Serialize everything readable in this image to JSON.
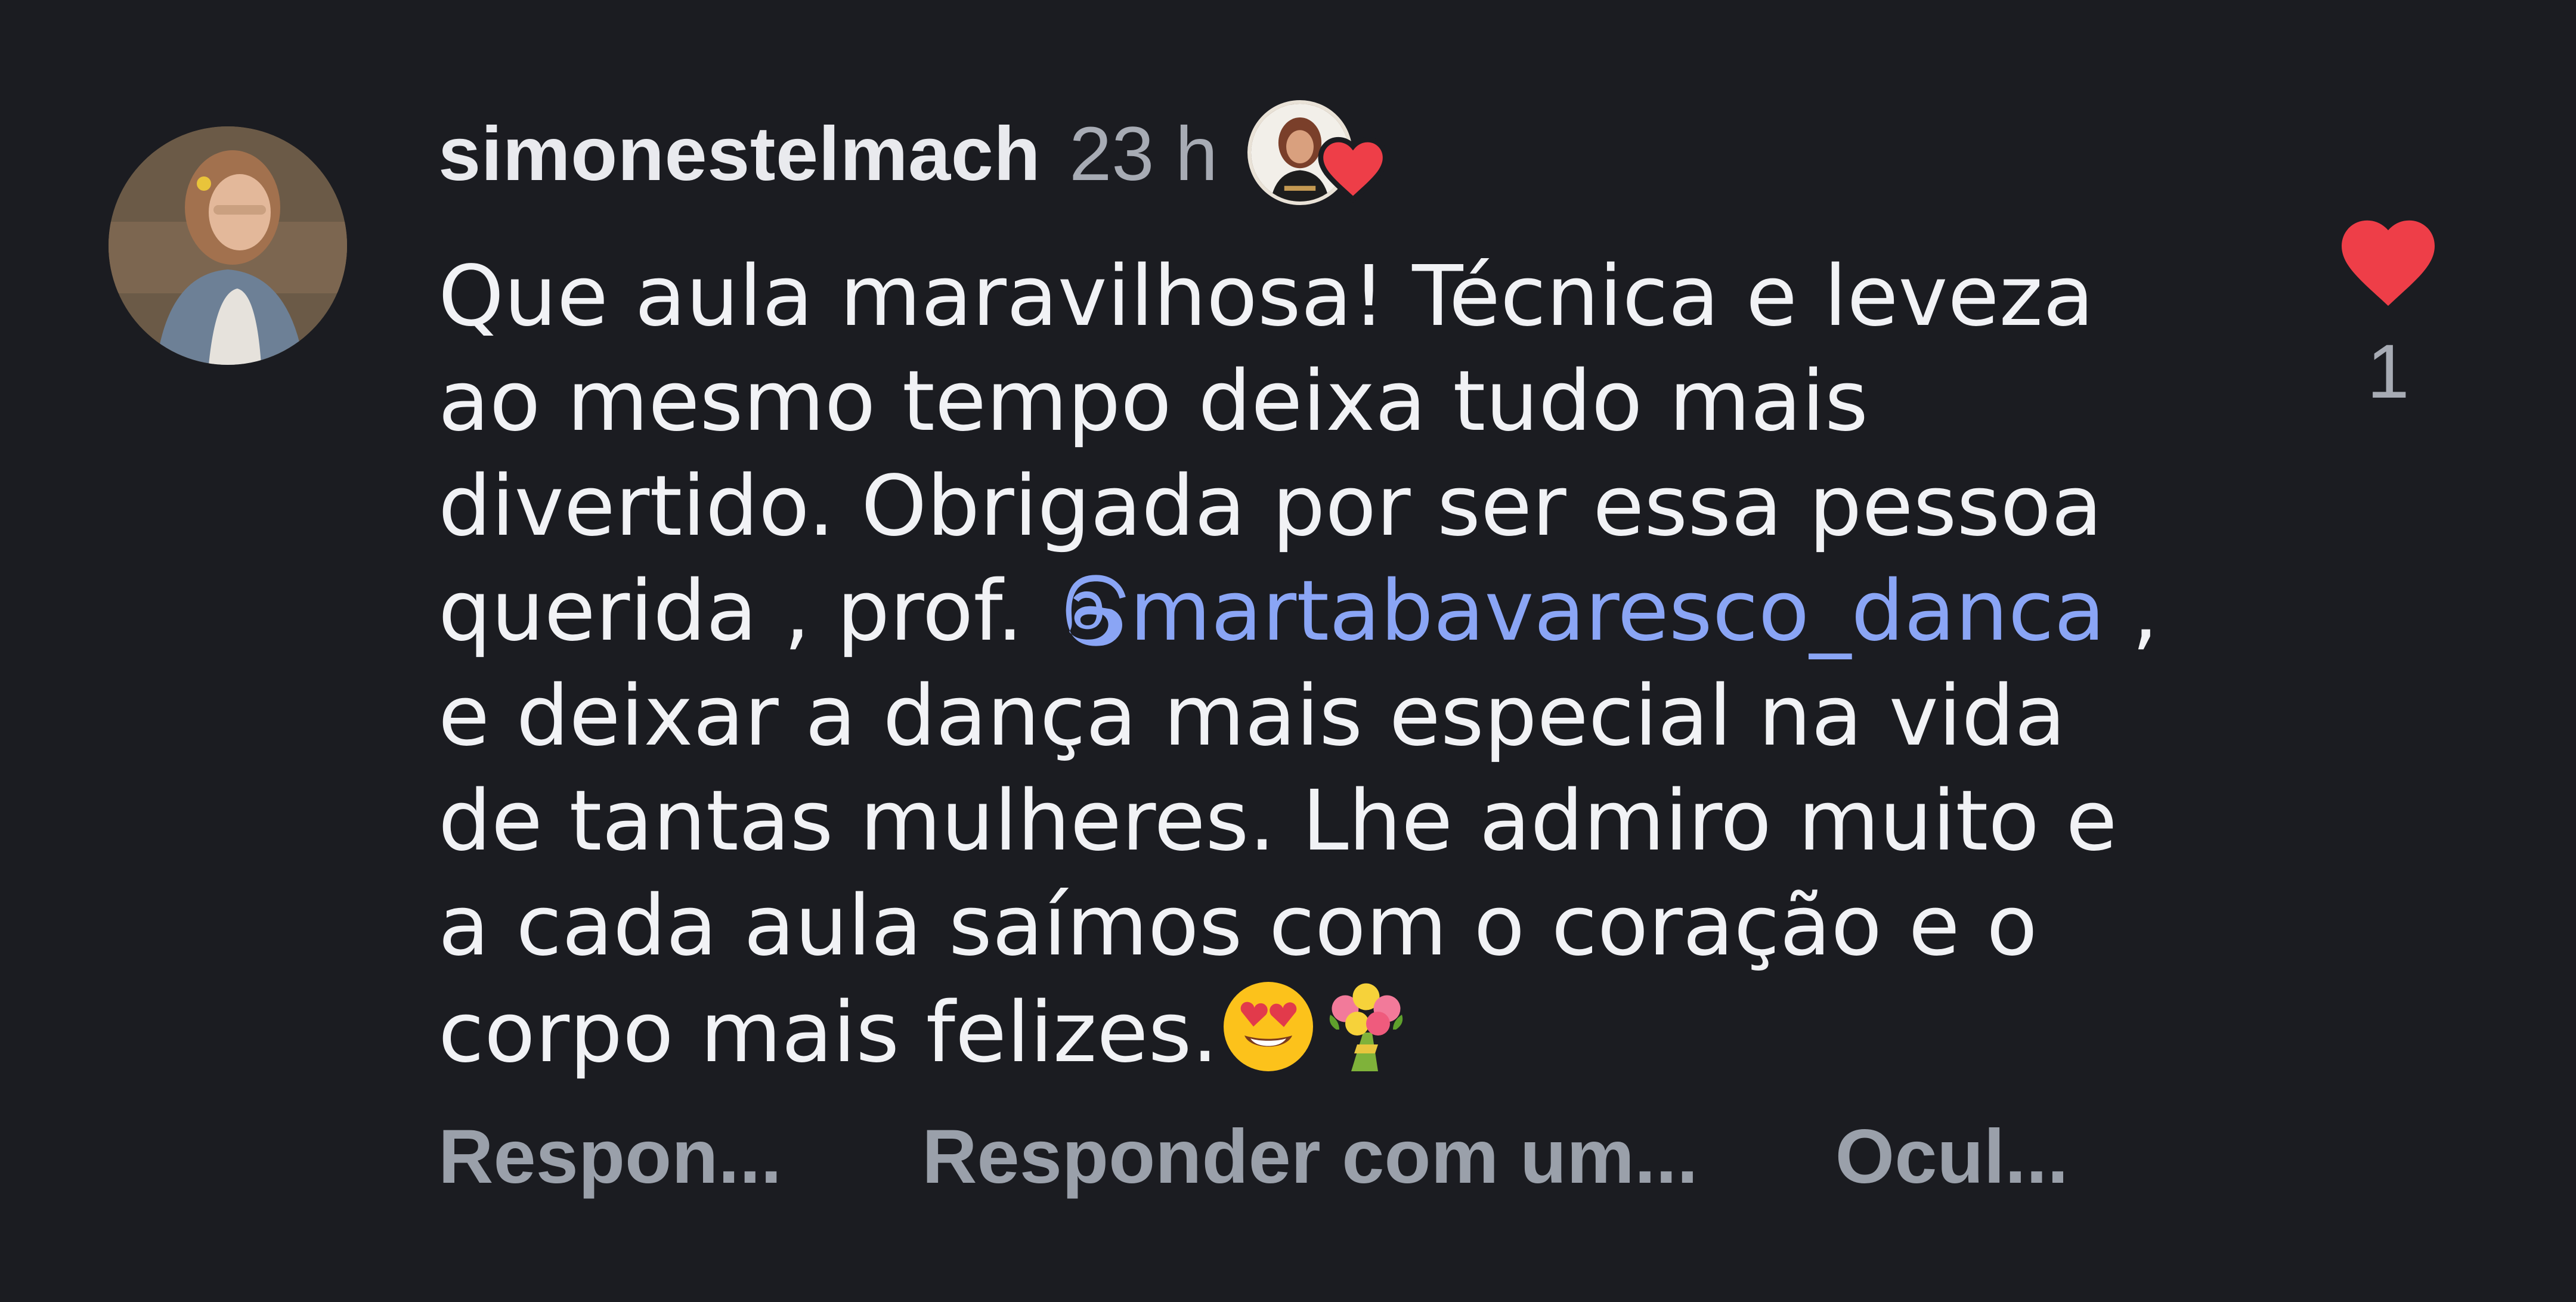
{
  "comment": {
    "username": "simonestelmach",
    "timestamp": "23 h",
    "text_before_mention": "Que aula maravilhosa! Técnica e leveza\nao mesmo tempo deixa tudo mais\ndivertido. Obrigada por ser essa pessoa\nquerida , prof. ",
    "mention": "martabavaresco_danca",
    "text_after_mention": " ,\ne deixar a dança mais especial na vida\nde tantas mulheres. Lhe admiro muito e\na cada aula saímos com o coração e o\ncorpo mais felizes.",
    "emojis": [
      "heart-eyes-emoji",
      "bouquet-emoji"
    ],
    "liked_by_creator": true
  },
  "like": {
    "count": "1",
    "liked": true,
    "color": "#ee3e48"
  },
  "actions": {
    "reply": "Respon...",
    "reply_with": "Responder com um...",
    "hide": "Ocul..."
  },
  "colors": {
    "background": "#1b1c21",
    "mention": "#8aa5f5",
    "muted": "#a7abb4"
  }
}
